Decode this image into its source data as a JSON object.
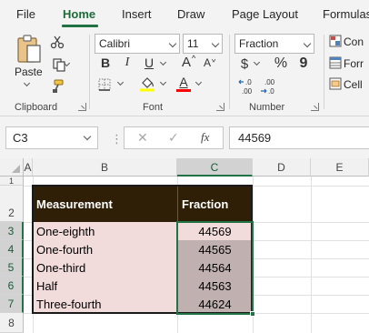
{
  "tabs": [
    "File",
    "Home",
    "Insert",
    "Draw",
    "Page Layout",
    "Formulas"
  ],
  "active_tab": "Home",
  "accent_color": "#217346",
  "ribbon": {
    "clipboard": {
      "label": "Clipboard",
      "paste_label": "Paste",
      "icons": [
        "paste-icon",
        "cut-icon",
        "copy-icon",
        "format-painter-icon"
      ]
    },
    "font": {
      "label": "Font",
      "font_name": "Calibri",
      "font_size": "11",
      "bold": "B",
      "italic": "I",
      "underline": "U",
      "grow": "A",
      "shrink": "A",
      "font_color_letter": "A",
      "highlight_color": "#ffff00",
      "font_color": "#ff0000"
    },
    "number": {
      "label": "Number",
      "format": "Fraction",
      "currency": "$",
      "percent": "%",
      "comma": "9",
      "increase_decimal": "←.0\n.00",
      "decrease_decimal": ".00\n→.0"
    },
    "styles": {
      "items": [
        "Con",
        "Forr",
        "Cell"
      ]
    }
  },
  "formula_bar": {
    "name_box": "C3",
    "cancel": "✕",
    "enter": "✓",
    "fx": "fx",
    "content": "44569"
  },
  "columns": [
    "A",
    "B",
    "C",
    "D",
    "E"
  ],
  "selected_column": "C",
  "rows": [
    "1",
    "2",
    "3",
    "4",
    "5",
    "6",
    "7",
    "8"
  ],
  "selected_rows": [
    "3",
    "4",
    "5",
    "6",
    "7"
  ],
  "table": {
    "headers": [
      "Measurement",
      "Fraction"
    ],
    "rows": [
      {
        "name": "One-eighth",
        "value": "44569"
      },
      {
        "name": "One-fourth",
        "value": "44565"
      },
      {
        "name": "One-third",
        "value": "44564"
      },
      {
        "name": "Half",
        "value": "44563"
      },
      {
        "name": "Three-fourth",
        "value": "44624"
      }
    ]
  },
  "colors": {
    "header_fill": "#2e1f06",
    "name_fill": "#f2dcdb",
    "active_cell_fill": "#f2dcdb",
    "selected_fill": "#c0b0b0"
  }
}
